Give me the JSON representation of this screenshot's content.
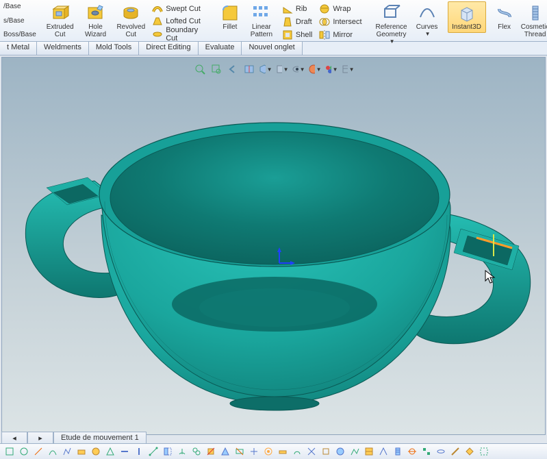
{
  "ribbon": {
    "left_stubs": [
      "/Base",
      "s/Base",
      "Boss/Base"
    ],
    "extruded_cut": "Extruded\nCut",
    "hole_wizard": "Hole\nWizard",
    "revolved_cut": "Revolved\nCut",
    "swept_cut": "Swept Cut",
    "lofted_cut": "Lofted Cut",
    "boundary_cut": "Boundary Cut",
    "fillet": "Fillet",
    "linear_pattern": "Linear\nPattern",
    "rib": "Rib",
    "draft": "Draft",
    "shell": "Shell",
    "wrap": "Wrap",
    "intersect": "Intersect",
    "mirror": "Mirror",
    "ref_geometry": "Reference\nGeometry",
    "curves": "Curves",
    "instant3d": "Instant3D",
    "flex": "Flex",
    "cosmetic_thread": "Cosmetic\nThread",
    "cosmetic_thread2": "Cosmetic\nThread"
  },
  "tabs": [
    "t Metal",
    "Weldments",
    "Mold Tools",
    "Direct Editing",
    "Evaluate",
    "Nouvel onglet"
  ],
  "bottom_tab": "Etude de mouvement 1",
  "colors": {
    "model_top": "#19A89F",
    "model_mid": "#1BB9AF",
    "model_dark": "#0E7E78",
    "model_inner": "#14867E"
  }
}
